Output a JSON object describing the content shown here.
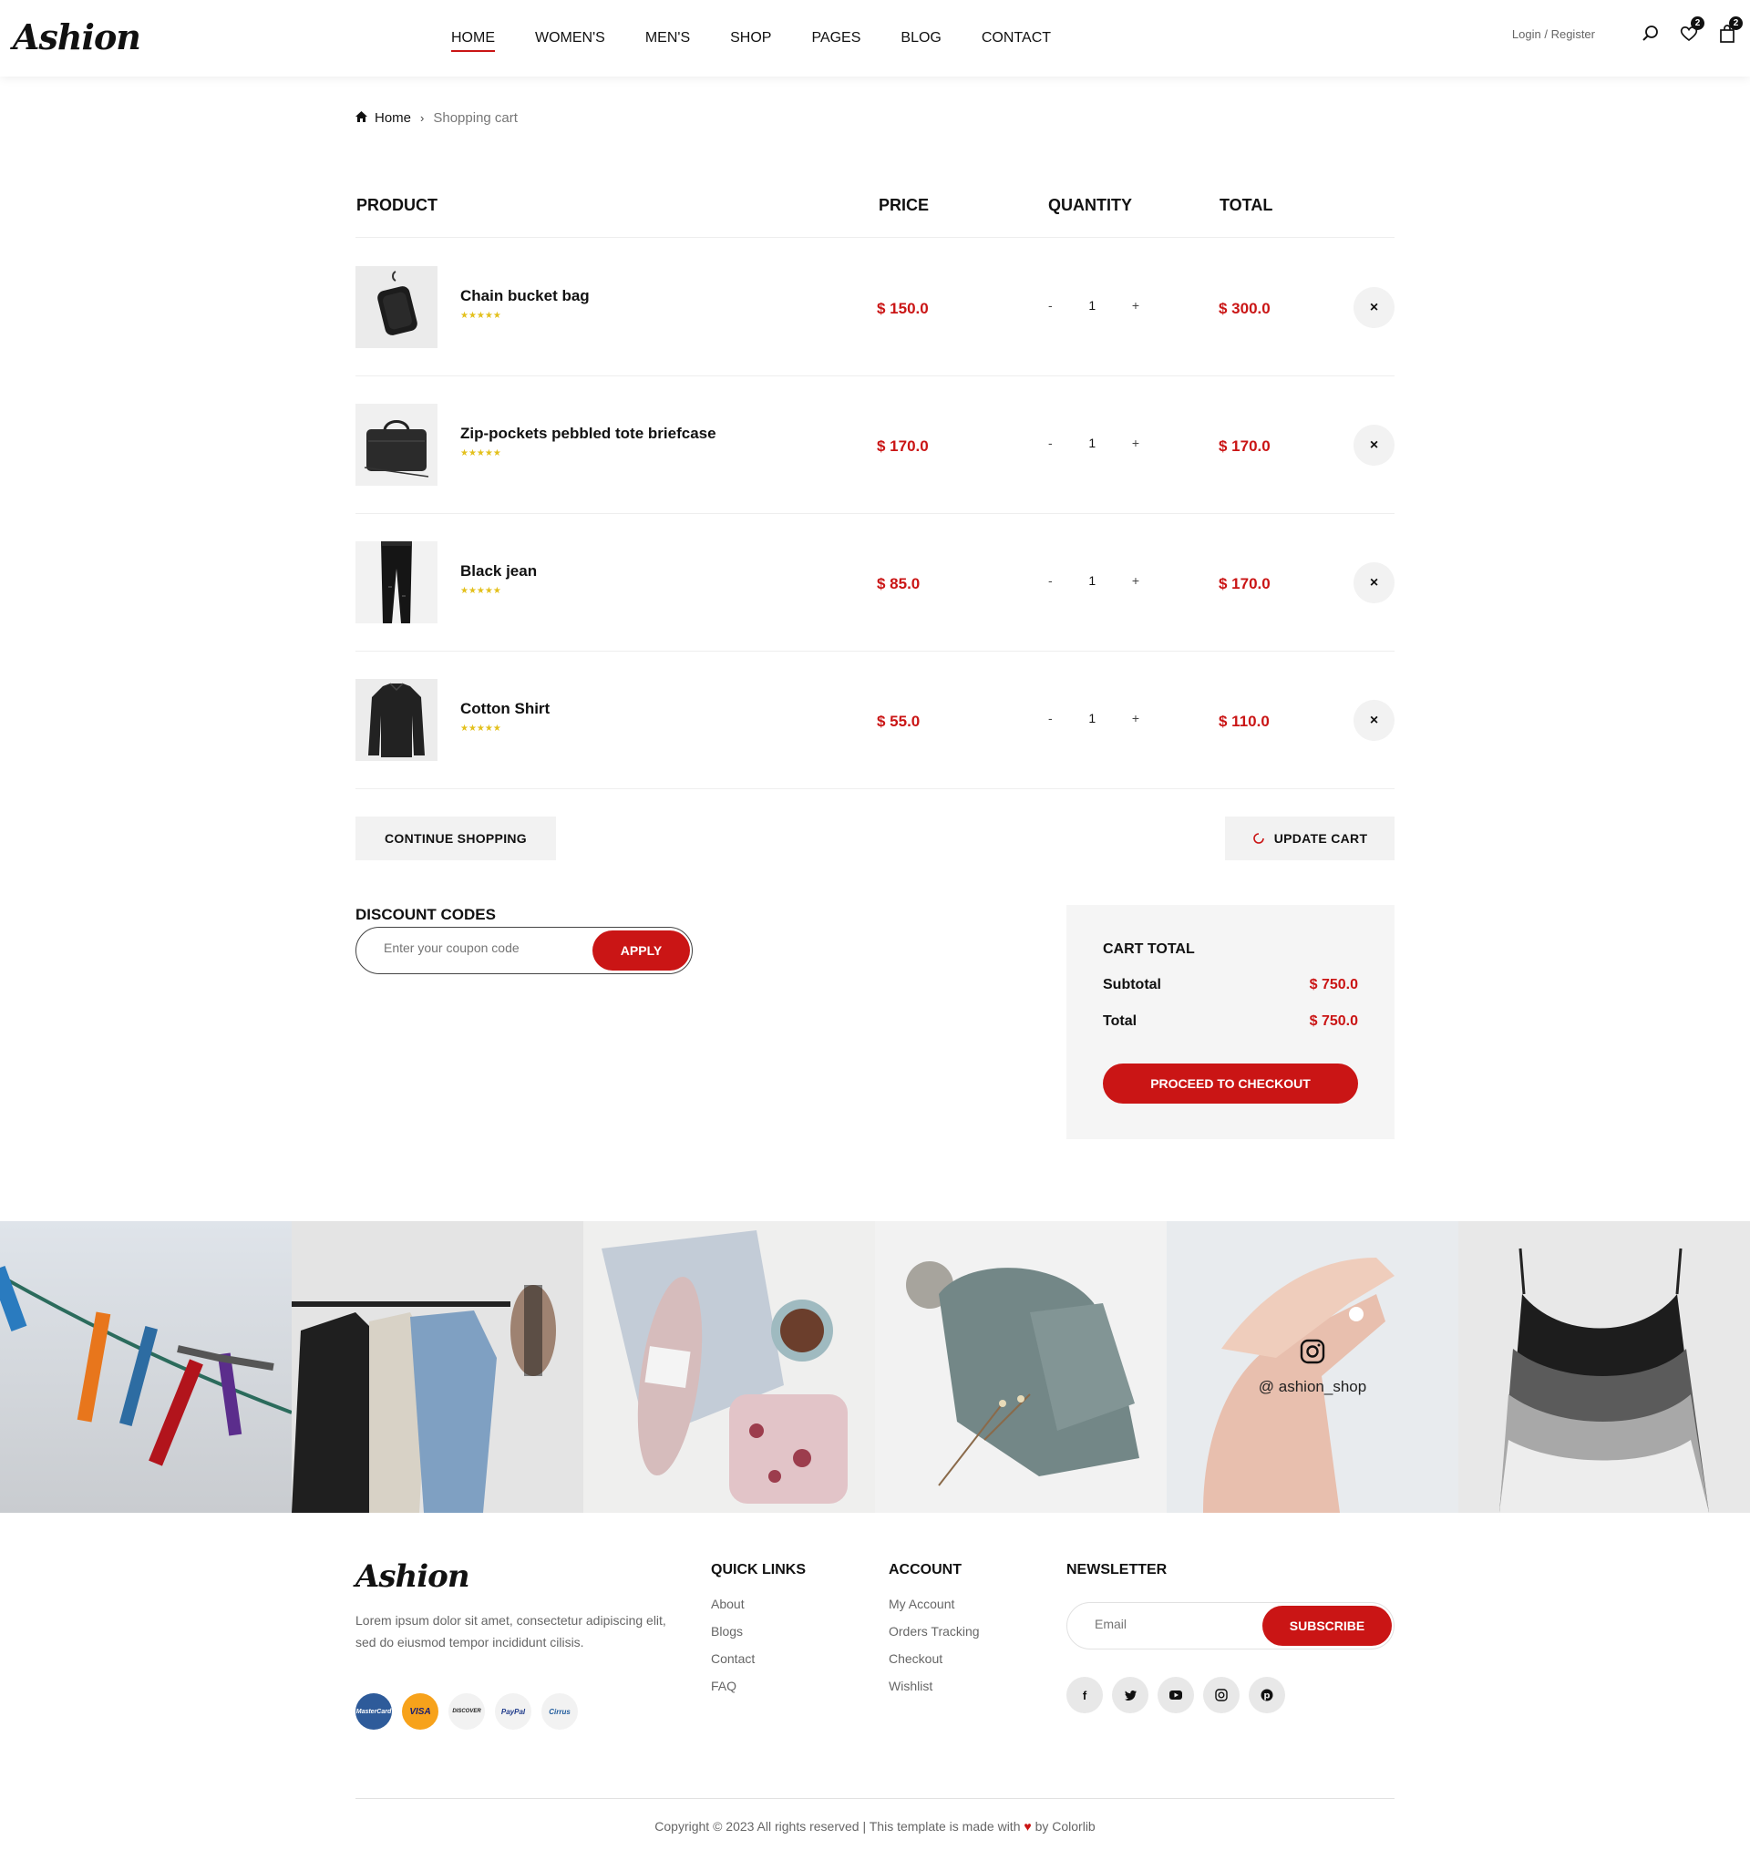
{
  "header": {
    "logo": "Ashion",
    "nav": [
      {
        "label": "HOME",
        "active": true
      },
      {
        "label": "WOMEN'S",
        "active": false
      },
      {
        "label": "MEN'S",
        "active": false
      },
      {
        "label": "SHOP",
        "active": false
      },
      {
        "label": "PAGES",
        "active": false
      },
      {
        "label": "BLOG",
        "active": false
      },
      {
        "label": "CONTACT",
        "active": false
      }
    ],
    "login": "Login",
    "separator": "/",
    "register": "Register",
    "wishlist_count": "2",
    "bag_count": "2",
    "icons": [
      "search-icon",
      "heart-icon",
      "shopping-bag-icon"
    ]
  },
  "breadcrumb": {
    "home": "Home",
    "current": "Shopping cart"
  },
  "cart": {
    "columns": [
      "PRODUCT",
      "PRICE",
      "QUANTITY",
      "TOTAL"
    ],
    "items": [
      {
        "name": "Chain bucket bag",
        "rating": "★★★★★",
        "price": "$ 150.0",
        "qty": "1",
        "total": "$ 300.0",
        "image": "bag-image"
      },
      {
        "name": "Zip-pockets pebbled tote briefcase",
        "rating": "★★★★★",
        "price": "$ 170.0",
        "qty": "1",
        "total": "$ 170.0",
        "image": "briefcase-image"
      },
      {
        "name": "Black jean",
        "rating": "★★★★★",
        "price": "$ 85.0",
        "qty": "1",
        "total": "$ 170.0",
        "image": "jeans-image"
      },
      {
        "name": "Cotton Shirt",
        "rating": "★★★★★",
        "price": "$ 55.0",
        "qty": "1",
        "total": "$ 110.0",
        "image": "shirt-image"
      }
    ],
    "qty_minus": "-",
    "qty_plus": "+",
    "remove_symbol": "×",
    "continue_label": "CONTINUE SHOPPING",
    "update_label": "UPDATE CART"
  },
  "discount": {
    "title": "DISCOUNT CODES",
    "placeholder": "Enter your coupon code",
    "apply_label": "APPLY"
  },
  "cart_total": {
    "title": "CART TOTAL",
    "subtotal_label": "Subtotal",
    "subtotal_value": "$ 750.0",
    "total_label": "Total",
    "total_value": "$ 750.0",
    "checkout_label": "PROCEED TO CHECKOUT"
  },
  "instagram": {
    "handle": "@ ashion_shop",
    "tiles": [
      "clothespins-image",
      "clothes-rack-image",
      "knitting-flatlay-image",
      "knit-hat-image",
      "hands-cream-image",
      "camisoles-image"
    ]
  },
  "footer": {
    "logo": "Ashion",
    "description": "Lorem ipsum dolor sit amet, consectetur adipiscing elit, sed do eiusmod tempor incididunt cilisis.",
    "payment_cards": [
      "MasterCard",
      "VISA",
      "DISCOVER",
      "PayPal",
      "Cirrus"
    ],
    "quick_links_title": "QUICK LINKS",
    "quick_links": [
      "About",
      "Blogs",
      "Contact",
      "FAQ"
    ],
    "account_title": "ACCOUNT",
    "account_links": [
      "My Account",
      "Orders Tracking",
      "Checkout",
      "Wishlist"
    ],
    "newsletter_title": "NEWSLETTER",
    "email_placeholder": "Email",
    "subscribe_label": "Subscribe",
    "socials": [
      "facebook-icon",
      "twitter-icon",
      "youtube-icon",
      "instagram-icon",
      "pinterest-icon"
    ],
    "copyright_pre": "Copyright © 2023 All rights reserved | This template is made with",
    "copyright_post": "by Colorlib"
  },
  "colors": {
    "accent": "#ca1515",
    "star": "#e3c01c",
    "muted_bg": "#f5f5f5"
  }
}
